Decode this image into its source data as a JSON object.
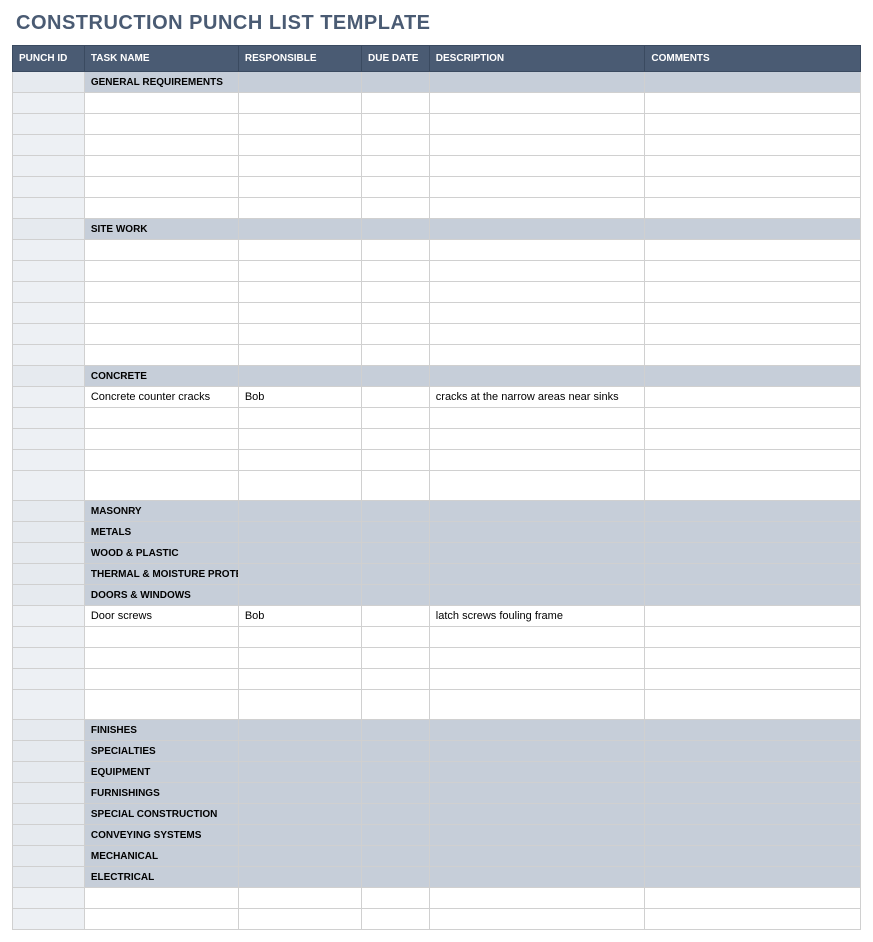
{
  "title": "CONSTRUCTION PUNCH LIST TEMPLATE",
  "columns": [
    "PUNCH ID",
    "TASK NAME",
    "RESPONSIBLE",
    "DUE DATE",
    "DESCRIPTION",
    "COMMENTS"
  ],
  "rows": [
    {
      "type": "section",
      "task": "GENERAL REQUIREMENTS"
    },
    {
      "type": "data"
    },
    {
      "type": "data"
    },
    {
      "type": "data"
    },
    {
      "type": "data"
    },
    {
      "type": "data"
    },
    {
      "type": "data"
    },
    {
      "type": "section",
      "task": "SITE WORK"
    },
    {
      "type": "data"
    },
    {
      "type": "data"
    },
    {
      "type": "data"
    },
    {
      "type": "data"
    },
    {
      "type": "data"
    },
    {
      "type": "data"
    },
    {
      "type": "section",
      "task": "CONCRETE"
    },
    {
      "type": "data",
      "task": "Concrete counter cracks",
      "responsible": "Bob",
      "description": "cracks at the narrow areas near sinks"
    },
    {
      "type": "data"
    },
    {
      "type": "data"
    },
    {
      "type": "data"
    },
    {
      "type": "data",
      "tall": true
    },
    {
      "type": "section",
      "task": "MASONRY"
    },
    {
      "type": "section",
      "task": "METALS"
    },
    {
      "type": "section",
      "task": "WOOD & PLASTIC"
    },
    {
      "type": "section",
      "task": "THERMAL & MOISTURE PROTECTION"
    },
    {
      "type": "section",
      "task": "DOORS & WINDOWS"
    },
    {
      "type": "data",
      "task": "Door screws",
      "responsible": "Bob",
      "description": "latch screws fouling frame"
    },
    {
      "type": "data"
    },
    {
      "type": "data"
    },
    {
      "type": "data"
    },
    {
      "type": "data",
      "tall": true
    },
    {
      "type": "section",
      "task": "FINISHES"
    },
    {
      "type": "section",
      "task": "SPECIALTIES"
    },
    {
      "type": "section",
      "task": "EQUIPMENT"
    },
    {
      "type": "section",
      "task": "FURNISHINGS"
    },
    {
      "type": "section",
      "task": "SPECIAL CONSTRUCTION"
    },
    {
      "type": "section",
      "task": "CONVEYING SYSTEMS"
    },
    {
      "type": "section",
      "task": "MECHANICAL"
    },
    {
      "type": "section",
      "task": "ELECTRICAL"
    },
    {
      "type": "data"
    },
    {
      "type": "data"
    }
  ]
}
